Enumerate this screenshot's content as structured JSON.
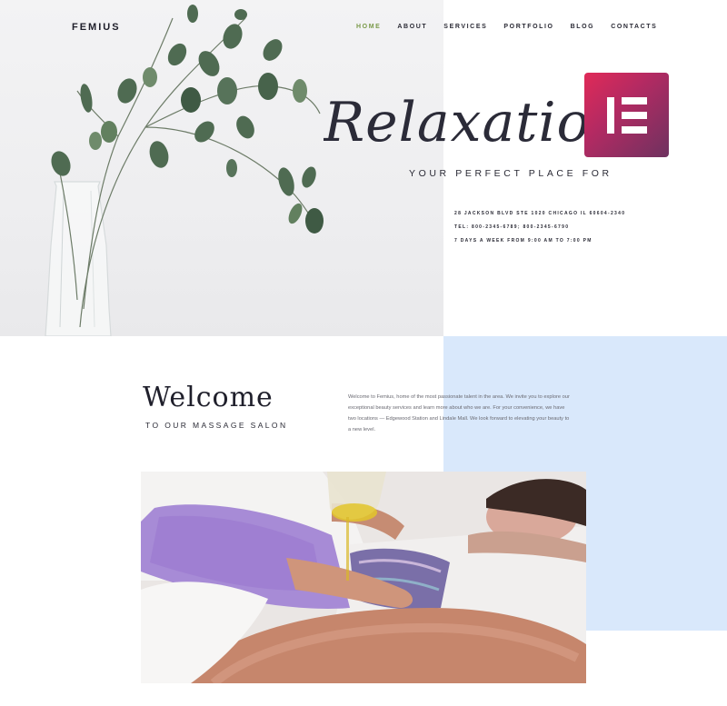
{
  "header": {
    "logo": "FEMIUS",
    "nav": [
      {
        "label": "HOME",
        "active": true
      },
      {
        "label": "ABOUT"
      },
      {
        "label": "SERVICES"
      },
      {
        "label": "PORTFOLIO"
      },
      {
        "label": "BLOG"
      },
      {
        "label": "CONTACTS"
      }
    ]
  },
  "hero": {
    "script_title": "Relaxation",
    "tagline": "YOUR PERFECT PLACE FOR",
    "address": "28 JACKSON BLVD STE 1020 CHICAGO IL 60604-2340",
    "phone": "TEL: 800-2345-6789; 800-2345-6790",
    "hours": "7 DAYS A WEEK FROM 9:00 AM TO 7:00 PM"
  },
  "welcome": {
    "title": "Welcome",
    "subtitle": "TO OUR MASSAGE SALON",
    "body": "Welcome to Femius, home of the most passionate talent in the area. We invite you to explore our exceptional beauty services and learn more about who we are. For your convenience, we have two locations — Edgewood Station and Lindale Mall. We look forward to elevating your beauty to a new level."
  },
  "colors": {
    "accent_green": "#7a9a4a",
    "blue_block": "#d9e8fb",
    "elementor_badge": "#c2295e"
  },
  "icons": {
    "elementor_badge": "elementor-logo-icon"
  }
}
